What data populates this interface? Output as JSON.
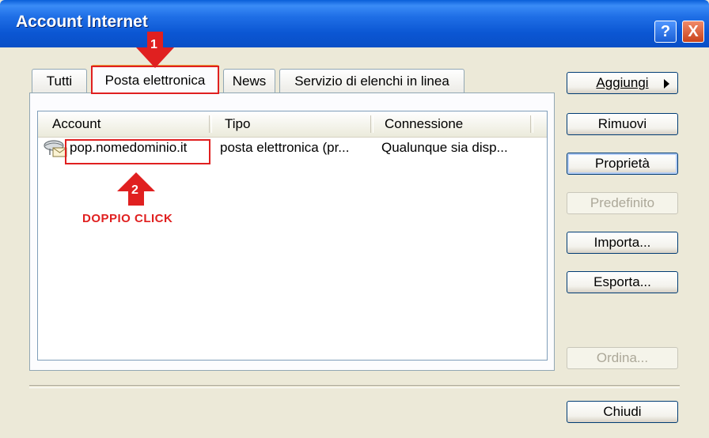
{
  "window": {
    "title": "Account Internet"
  },
  "titlebar": {
    "help_label": "?",
    "close_label": "X"
  },
  "tabs": [
    {
      "label": "Tutti"
    },
    {
      "label": "Posta elettronica"
    },
    {
      "label": "News"
    },
    {
      "label": "Servizio di elenchi in linea"
    }
  ],
  "list": {
    "columns": [
      "Account",
      "Tipo",
      "Connessione"
    ],
    "rows": [
      {
        "account": "pop.nomedominio.it",
        "tipo": "posta elettronica (pr...",
        "connessione": "Qualunque sia disp..."
      }
    ]
  },
  "buttons": {
    "aggiungi": "Aggiungi",
    "rimuovi": "Rimuovi",
    "proprieta": "Proprietà",
    "predefinito": "Predefinito",
    "importa": "Importa...",
    "esporta": "Esporta...",
    "ordina": "Ordina...",
    "chiudi": "Chiudi"
  },
  "annotations": {
    "marker1": "1",
    "marker2": "2",
    "caption": "DOPPIO CLICK",
    "color": "#e02020"
  }
}
